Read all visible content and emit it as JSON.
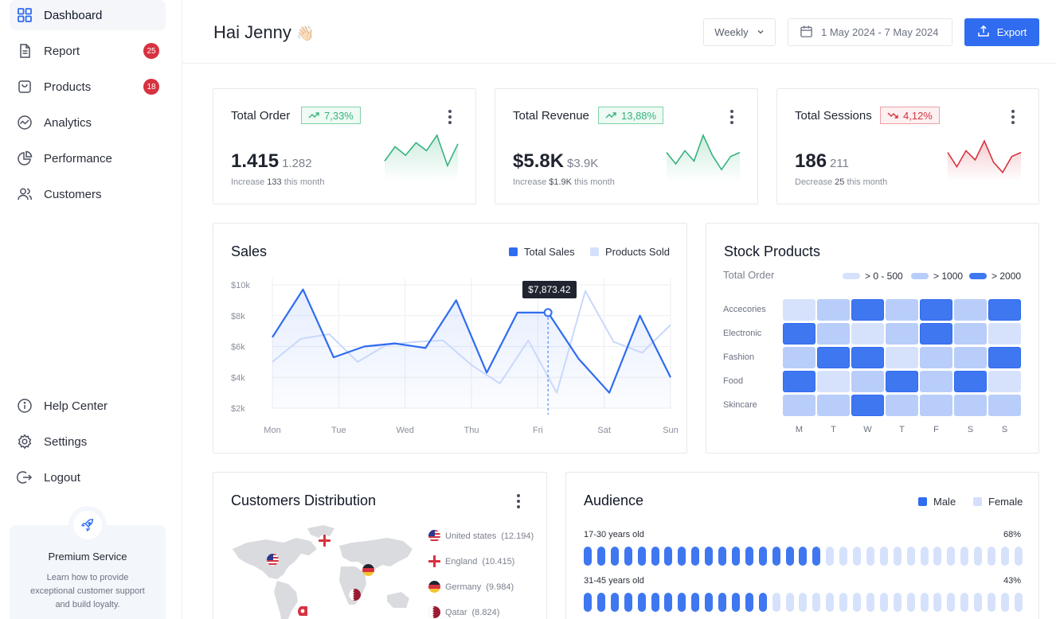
{
  "sidebar": {
    "nav": [
      {
        "label": "Dashboard",
        "icon": "grid-icon",
        "active": true
      },
      {
        "label": "Report",
        "icon": "document-icon",
        "badge": "25"
      },
      {
        "label": "Products",
        "icon": "bag-icon",
        "badge": "18"
      },
      {
        "label": "Analytics",
        "icon": "analytics-icon"
      },
      {
        "label": "Performance",
        "icon": "pie-chart-icon"
      },
      {
        "label": "Customers",
        "icon": "users-icon"
      }
    ],
    "bottom_nav": [
      {
        "label": "Help Center",
        "icon": "info-icon"
      },
      {
        "label": "Settings",
        "icon": "gear-icon"
      },
      {
        "label": "Logout",
        "icon": "logout-icon"
      }
    ],
    "premium": {
      "title": "Premium Service",
      "description": "Learn how to provide exceptional customer support and build loyalty.",
      "icon": "rocket-icon"
    }
  },
  "header": {
    "greeting": "Hai Jenny",
    "greeting_emoji": "👋🏻",
    "period_select": "Weekly",
    "date_range": "1 May 2024 - 7 May 2024",
    "export_label": "Export"
  },
  "colors": {
    "accent": "#2f6cf0",
    "accent_light": "#c9d8fb",
    "positive": "#36b37e",
    "negative": "#d6323f"
  },
  "stats": [
    {
      "title": "Total Order",
      "change": "7,33%",
      "trend": "up",
      "value": "1.415",
      "previous": "1.282",
      "note_prefix": "Increase",
      "note_value": "133",
      "note_suffix": "this month",
      "spark": [
        30,
        55,
        40,
        62,
        48,
        75,
        22,
        60
      ]
    },
    {
      "title": "Total Revenue",
      "change": "13,88%",
      "trend": "up",
      "value": "$5.8K",
      "previous": "$3.9K",
      "note_prefix": "Increase",
      "note_value": "$1.9K",
      "note_suffix": "this month",
      "spark": [
        45,
        25,
        48,
        30,
        75,
        40,
        15,
        38,
        45
      ]
    },
    {
      "title": "Total Sessions",
      "change": "4,12%",
      "trend": "down",
      "value": "186",
      "previous": "211",
      "note_prefix": "Decrease",
      "note_value": "25",
      "note_suffix": "this month",
      "spark": [
        45,
        20,
        48,
        32,
        65,
        28,
        10,
        38,
        45
      ]
    }
  ],
  "sales": {
    "title": "Sales",
    "tooltip": "$7,873.42",
    "chart_data": {
      "type": "line",
      "categories": [
        "Mon",
        "Tue",
        "Wed",
        "Thu",
        "Fri",
        "Sat",
        "Sun"
      ],
      "y_ticks": [
        "$10k",
        "$8k",
        "$6k",
        "$4k",
        "$2k"
      ],
      "ylim": [
        2000,
        10000
      ],
      "series": [
        {
          "name": "Total Sales",
          "color": "#2f6cf0",
          "values": [
            6600,
            9700,
            5300,
            6000,
            6200,
            5900,
            9000,
            4300,
            8200,
            8200,
            5200,
            3000,
            8000,
            4000
          ]
        },
        {
          "name": "Products Sold",
          "color": "#c9d8fb",
          "values": [
            5000,
            6500,
            6800,
            5000,
            6100,
            6300,
            6400,
            4800,
            3600,
            6400,
            3000,
            9600,
            6300,
            5600,
            7400
          ]
        }
      ],
      "highlight": {
        "series": "Total Sales",
        "point_index": 9,
        "label": "$7,873.42"
      }
    }
  },
  "stock": {
    "title": "Stock Products",
    "subtitle": "Total Order",
    "legend": [
      "> 0 - 500",
      "> 1000",
      "> 2000"
    ],
    "rows": [
      "Accecories",
      "Electronic",
      "Fashion",
      "Food",
      "Skincare"
    ],
    "cols": [
      "M",
      "T",
      "W",
      "T",
      "F",
      "S",
      "S"
    ],
    "chart_data": {
      "type": "heatmap",
      "levels": [
        "> 0 - 500",
        "> 1000",
        "> 2000"
      ],
      "values": [
        [
          1,
          2,
          3,
          2,
          3,
          2,
          3
        ],
        [
          3,
          2,
          1,
          2,
          3,
          2,
          1
        ],
        [
          2,
          3,
          3,
          1,
          2,
          2,
          3
        ],
        [
          3,
          1,
          2,
          3,
          2,
          3,
          1
        ],
        [
          2,
          2,
          3,
          2,
          2,
          2,
          2
        ]
      ]
    }
  },
  "distribution": {
    "title": "Customers Distribution",
    "items": [
      {
        "country": "United states",
        "count": "(12.194)",
        "flag": "us-flag-icon"
      },
      {
        "country": "England",
        "count": "(10.415)",
        "flag": "england-flag-icon"
      },
      {
        "country": "Germany",
        "count": "(9.984)",
        "flag": "germany-flag-icon"
      },
      {
        "country": "Qatar",
        "count": "(8.824)",
        "flag": "qatar-flag-icon"
      }
    ]
  },
  "audience": {
    "title": "Audience",
    "legend": [
      "Male",
      "Female"
    ],
    "groups": [
      {
        "label": "17-30 years old",
        "percent": "68%",
        "male_fraction": 0.55
      },
      {
        "label": "31-45 years old",
        "percent": "43%",
        "male_fraction": 0.43
      }
    ]
  }
}
